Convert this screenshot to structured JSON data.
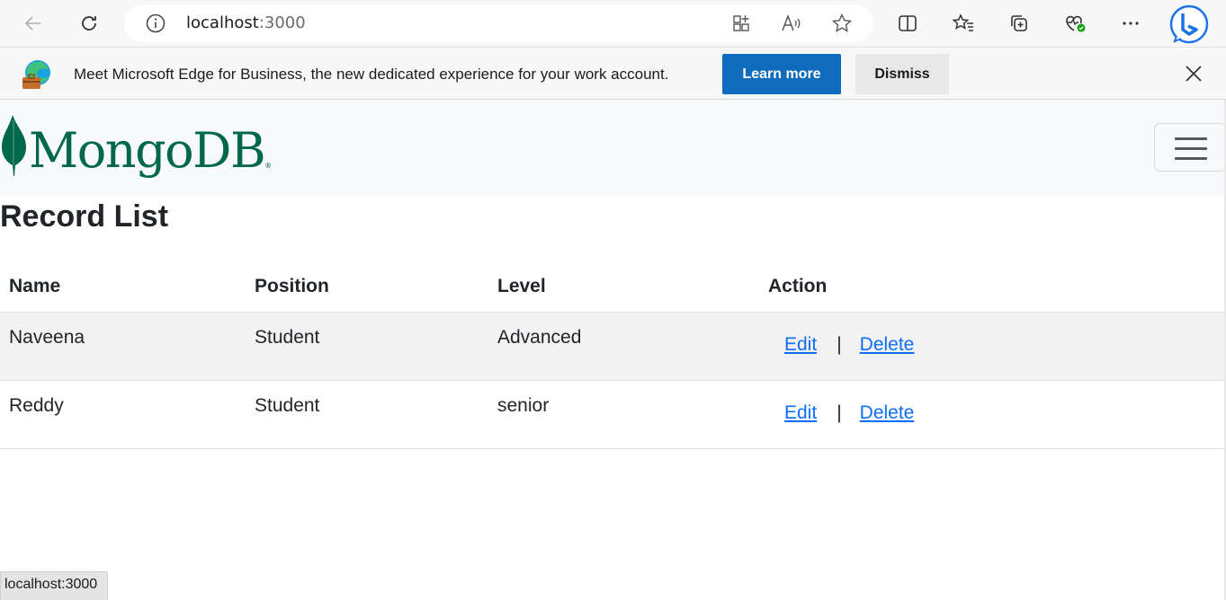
{
  "browser": {
    "url_host": "localhost",
    "url_port": ":3000",
    "icons": [
      "back-icon",
      "refresh-icon",
      "site-info-icon",
      "app-available-icon",
      "read-aloud-icon",
      "favorite-star-icon",
      "split-screen-icon",
      "favorites-icon",
      "collections-icon",
      "browser-essentials-icon",
      "more-icon",
      "copilot-icon"
    ]
  },
  "infobar": {
    "message": "Meet Microsoft Edge for Business, the new dedicated experience for your work account.",
    "learn_more": "Learn more",
    "dismiss": "Dismiss"
  },
  "navbar": {
    "brand": "MongoDB",
    "brand_mark": "®"
  },
  "page": {
    "title": "Record List",
    "columns": [
      "Name",
      "Position",
      "Level",
      "Action"
    ],
    "rows": [
      {
        "name": "Naveena",
        "position": "Student",
        "level": "Advanced",
        "edit": "Edit",
        "sep": "|",
        "delete": "Delete"
      },
      {
        "name": "Reddy",
        "position": "Student",
        "level": "senior",
        "edit": "Edit",
        "sep": "|",
        "delete": "Delete"
      }
    ]
  },
  "status_bar": {
    "text": "localhost:3000"
  },
  "colors": {
    "mongo_green": "#00684a",
    "edge_blue": "#0f6cbd",
    "link_blue": "#0d6efd"
  }
}
